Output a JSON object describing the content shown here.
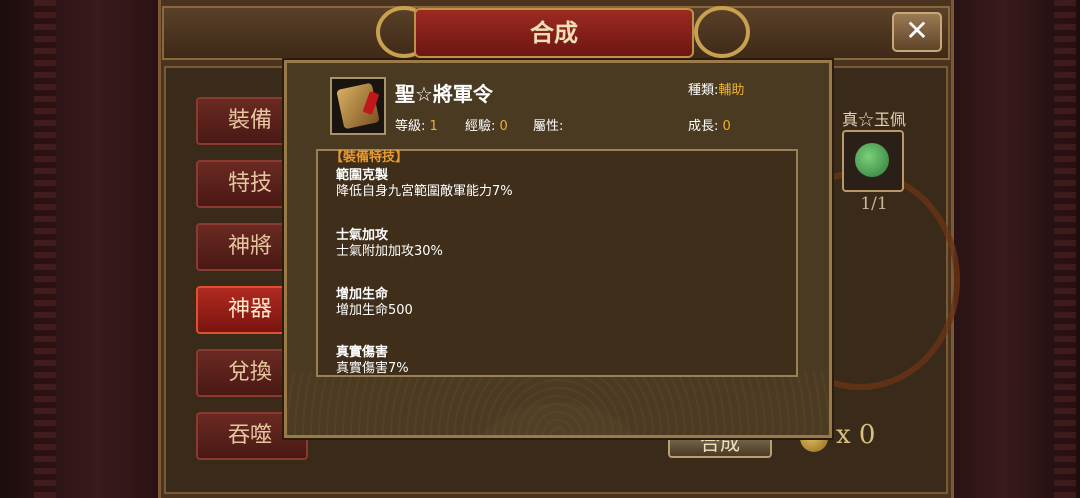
{
  "window": {
    "title": "合成",
    "close_label": "✕"
  },
  "sidebar": {
    "items": [
      {
        "label": "裝備",
        "active": false
      },
      {
        "label": "特技",
        "active": false
      },
      {
        "label": "神將",
        "active": false
      },
      {
        "label": "神器",
        "active": true
      },
      {
        "label": "兌換",
        "active": false
      },
      {
        "label": "吞噬",
        "active": false
      }
    ]
  },
  "right_panel": {
    "item_name": "真☆玉佩",
    "count": "1/1"
  },
  "synth": {
    "button_label": "合成",
    "coin_count": "x 0"
  },
  "popup": {
    "item_name": "聖☆將軍令",
    "level_label": "等級:",
    "level_value": "1",
    "exp_label": "經驗:",
    "exp_value": "0",
    "attr_label": "屬性:",
    "attr_value": "",
    "type_label": "種類:",
    "type_value": "輔助",
    "growth_label": "成長:",
    "growth_value": "0",
    "skills_header": "【裝備特技】",
    "skills": [
      {
        "name": "範圍克製",
        "desc": "降低自身九宮範圍敵軍能力7%"
      },
      {
        "name": "士氣加攻",
        "desc": "士氣附加加攻30%"
      },
      {
        "name": "增加生命",
        "desc": "增加生命500"
      },
      {
        "name": "真實傷害",
        "desc": "真實傷害7%"
      }
    ]
  },
  "colors": {
    "accent_gold": "#f0b030",
    "header_orange": "#e89a30",
    "active_red": "#b02a20"
  }
}
